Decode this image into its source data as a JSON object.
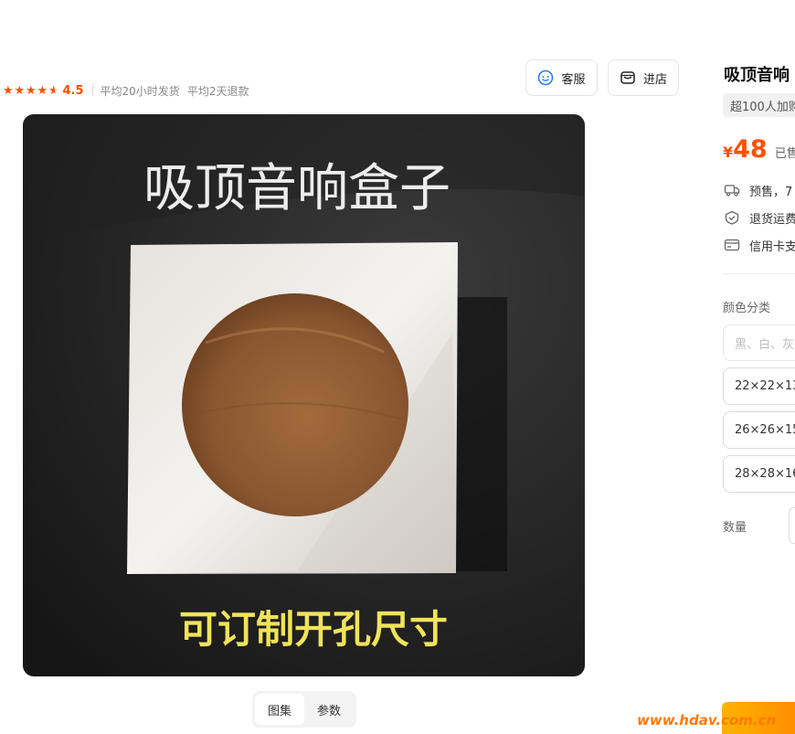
{
  "rating": {
    "stars": 4.5,
    "value": "4.5"
  },
  "meta": {
    "ship": "平均20小时发货",
    "refund": "平均2天退款"
  },
  "buttons": {
    "service": "客服",
    "store": "进店"
  },
  "gallery": {
    "headline": "吸顶音响盒子",
    "caption": "可订制开孔尺寸",
    "tabs": [
      "图集",
      "参数"
    ]
  },
  "product": {
    "title": "吸顶音响",
    "badge": "超100人加购",
    "currency": "¥",
    "price": "48",
    "sold": "已售",
    "presale": "预售，7",
    "returns": "退货运费",
    "credit": "信用卡支"
  },
  "options": {
    "color_label": "颜色分类",
    "color_placeholder": "黑、白、灰",
    "sizes": [
      "22×22×13",
      "26×26×15",
      "28×28×16"
    ],
    "qty_label": "数量"
  },
  "watermark": "www.hdav.com.cn",
  "colors": {
    "accent": "#ff5000"
  }
}
